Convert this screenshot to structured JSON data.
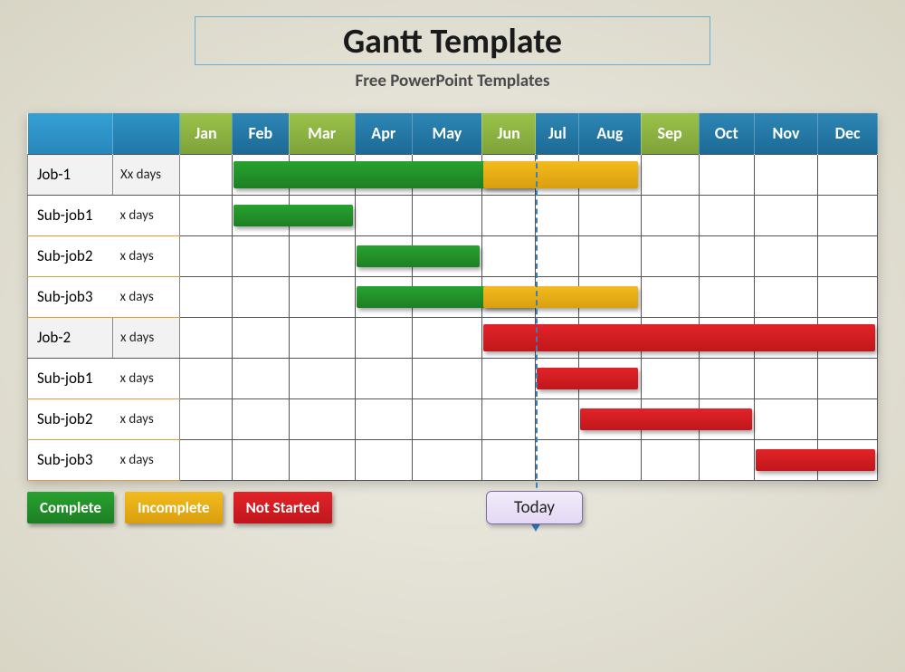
{
  "title": "Gantt Template",
  "subtitle": "Free PowerPoint Templates",
  "months": [
    "Jan",
    "Feb",
    "Mar",
    "Apr",
    "May",
    "Jun",
    "Jul",
    "Aug",
    "Sep",
    "Oct",
    "Nov",
    "Dec"
  ],
  "month_header_colors": [
    "green",
    "blue",
    "green",
    "blue",
    "blue",
    "green",
    "blue",
    "blue",
    "green",
    "blue",
    "blue",
    "blue"
  ],
  "rows": [
    {
      "name": "Job-1",
      "duration": "Xx days",
      "type": "main"
    },
    {
      "name": "Sub-job1",
      "duration": "x days",
      "type": "sub"
    },
    {
      "name": "Sub-job2",
      "duration": "x days",
      "type": "sub"
    },
    {
      "name": "Sub-job3",
      "duration": "x days",
      "type": "sub"
    },
    {
      "name": "Job-2",
      "duration": "x days",
      "type": "main"
    },
    {
      "name": "Sub-job1",
      "duration": "x days",
      "type": "sub"
    },
    {
      "name": "Sub-job2",
      "duration": "x days",
      "type": "sub"
    },
    {
      "name": "Sub-job3",
      "duration": "x days",
      "type": "sub"
    }
  ],
  "legend": {
    "complete": "Complete",
    "incomplete": "Incomplete",
    "notstarted": "Not Started"
  },
  "today_label": "Today",
  "today_at_month": "Jun",
  "colors": {
    "complete": "#1e8f24",
    "incomplete": "#e0a912",
    "notstarted": "#d11a1f"
  },
  "chart_data": {
    "type": "gantt",
    "title": "Gantt Template",
    "x_axis": [
      "Jan",
      "Feb",
      "Mar",
      "Apr",
      "May",
      "Jun",
      "Jul",
      "Aug",
      "Sep",
      "Oct",
      "Nov",
      "Dec"
    ],
    "today_marker_after": "Jun",
    "legend": {
      "Complete": "green",
      "Incomplete": "yellow",
      "Not Started": "red"
    },
    "tasks": [
      {
        "row": "Job-1",
        "segments": [
          {
            "status": "Complete",
            "start": "Feb",
            "end": "Jun"
          },
          {
            "status": "Incomplete",
            "start": "Jun",
            "end": "Aug"
          }
        ]
      },
      {
        "row": "Sub-job1",
        "segments": [
          {
            "status": "Complete",
            "start": "Feb",
            "end": "Mar"
          }
        ]
      },
      {
        "row": "Sub-job2",
        "segments": [
          {
            "status": "Complete",
            "start": "Apr",
            "end": "May"
          }
        ]
      },
      {
        "row": "Sub-job3",
        "segments": [
          {
            "status": "Complete",
            "start": "Apr",
            "end": "Jun"
          },
          {
            "status": "Incomplete",
            "start": "Jun",
            "end": "Aug"
          }
        ]
      },
      {
        "row": "Job-2",
        "segments": [
          {
            "status": "Not Started",
            "start": "Jun",
            "end": "Dec"
          }
        ]
      },
      {
        "row": "Sub-job1",
        "segments": [
          {
            "status": "Not Started",
            "start": "Jul",
            "end": "Aug"
          }
        ]
      },
      {
        "row": "Sub-job2",
        "segments": [
          {
            "status": "Not Started",
            "start": "Aug",
            "end": "Oct"
          }
        ]
      },
      {
        "row": "Sub-job3",
        "segments": [
          {
            "status": "Not Started",
            "start": "Nov",
            "end": "Dec"
          }
        ]
      }
    ]
  }
}
